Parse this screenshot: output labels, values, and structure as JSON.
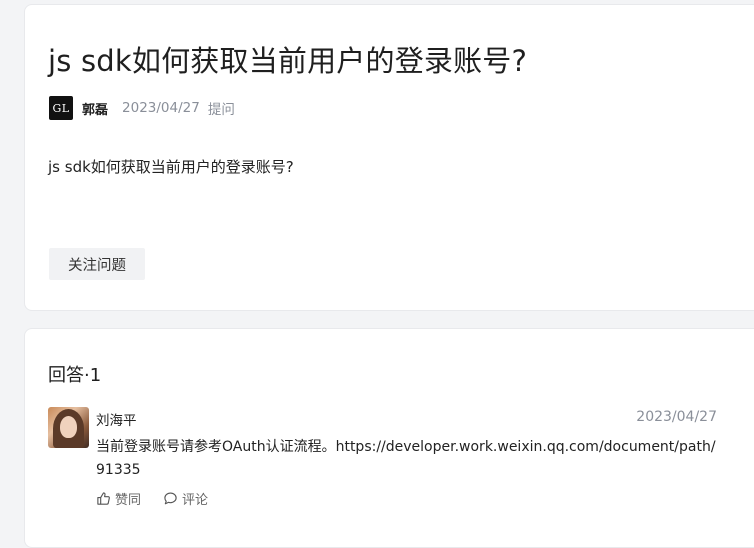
{
  "question": {
    "title": "js sdk如何获取当前用户的登录账号?",
    "author_avatar_text": "GL",
    "author": "郭磊",
    "date": "2023/04/27",
    "action": "提问",
    "body": "js sdk如何获取当前用户的登录账号?",
    "follow_label": "关注问题"
  },
  "answers": {
    "heading": "回答·1",
    "items": [
      {
        "name": "刘海平",
        "date": "2023/04/27",
        "body": "当前登录账号请参考OAuth认证流程。https://developer.work.weixin.qq.com/document/path/91335",
        "like_label": "赞同",
        "comment_label": "评论"
      }
    ]
  },
  "icons": {
    "like": "thumbs-up-icon",
    "comment": "comment-bubble-icon"
  }
}
